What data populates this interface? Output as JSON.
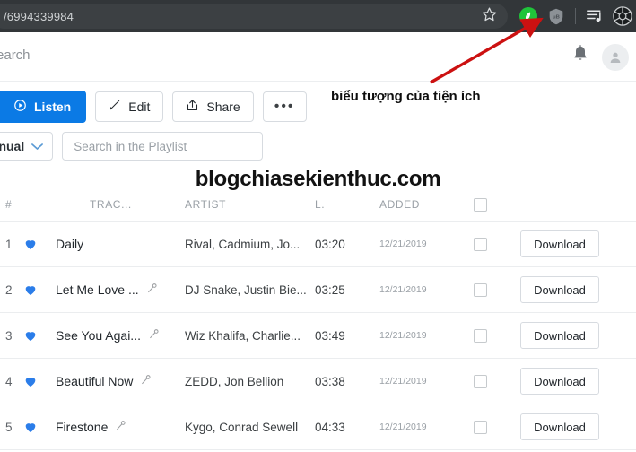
{
  "browser": {
    "url_text": "/6994339984",
    "icons": [
      {
        "name": "bookmark-star-icon",
        "label": "star"
      },
      {
        "name": "extension-green-icon",
        "label": "extension"
      },
      {
        "name": "ublock-shield-icon",
        "label": "uB"
      },
      {
        "name": "playlist-downloader-icon",
        "label": "playlist"
      },
      {
        "name": "browser-profile-icon",
        "label": "profile"
      }
    ]
  },
  "site_header": {
    "search_text": "Search",
    "bell_icon": "notification-bell-icon",
    "avatar_icon": "user-avatar-icon"
  },
  "toolbar": {
    "listen_label": "Listen",
    "edit_label": "Edit",
    "share_label": "Share",
    "more_label": "•••"
  },
  "annotation": {
    "text": "biểu tượng của tiện ích",
    "arrow_color": "#cc1111"
  },
  "filters": {
    "sort_label": "Manual",
    "search_placeholder": "Search in the Playlist",
    "search_value": ""
  },
  "watermark": {
    "text": "blogchiasekienthuc.com"
  },
  "table": {
    "headers": {
      "num": "#",
      "track": "TRAC...",
      "artist": "ARTIST",
      "length": "L.",
      "added": "ADDED"
    },
    "download_label": "Download",
    "rows": [
      {
        "num": "1",
        "track": "Daily",
        "has_mic": false,
        "artist": "Rival, Cadmium, Jo...",
        "length": "03:20",
        "added": "12/21/2019",
        "liked": true,
        "checked": false
      },
      {
        "num": "2",
        "track": "Let Me Love ...",
        "has_mic": true,
        "artist": "DJ Snake, Justin Bie...",
        "length": "03:25",
        "added": "12/21/2019",
        "liked": true,
        "checked": false
      },
      {
        "num": "3",
        "track": "See You Agai...",
        "has_mic": true,
        "artist": "Wiz Khalifa, Charlie...",
        "length": "03:49",
        "added": "12/21/2019",
        "liked": true,
        "checked": false
      },
      {
        "num": "4",
        "track": "Beautiful Now",
        "has_mic": true,
        "artist": "ZEDD, Jon Bellion",
        "length": "03:38",
        "added": "12/21/2019",
        "liked": true,
        "checked": false
      },
      {
        "num": "5",
        "track": "Firestone",
        "has_mic": true,
        "artist": "Kygo, Conrad Sewell",
        "length": "04:33",
        "added": "12/21/2019",
        "liked": true,
        "checked": false
      }
    ]
  },
  "colors": {
    "accent_blue": "#0b7ae5",
    "heart_blue": "#2b7de9",
    "chrome_dark": "#323639",
    "ext_green": "#1fc43a",
    "arrow_red": "#cc1111"
  }
}
